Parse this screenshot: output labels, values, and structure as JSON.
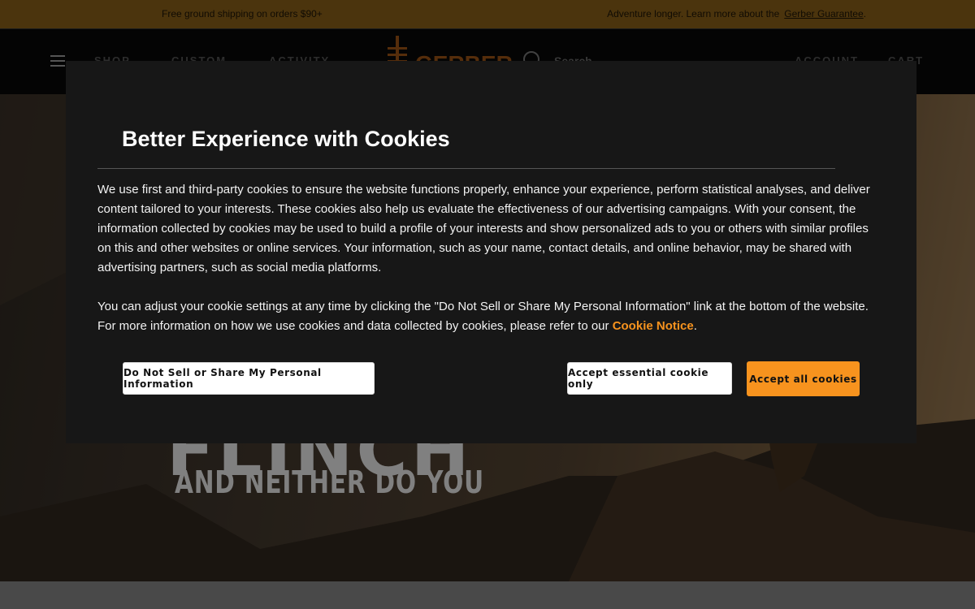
{
  "announcement": {
    "left_text": "Free ground shipping on orders $90+",
    "right_text": "Adventure longer. Learn more about the",
    "right_link": "Gerber Guarantee",
    "right_suffix": "."
  },
  "header": {
    "nav": [
      {
        "label": "SHOP"
      },
      {
        "label": "CUSTOM"
      },
      {
        "label": "ACTIVITY"
      }
    ],
    "logo_text": "GERBER",
    "search_label": "Search",
    "account_label": "ACCOUNT",
    "cart_label": "CART"
  },
  "hero": {
    "headline": "FLINCH",
    "subheadline": "AND NEITHER DO YOU"
  },
  "cookie_modal": {
    "title": "Better Experience with Cookies",
    "paragraph1": "We use first and third-party cookies to ensure the website functions properly, enhance your experience, perform statistical analyses, and deliver content tailored to your interests. These cookies also help us evaluate the effectiveness of our advertising campaigns. With your consent, the information collected by cookies may be used to build a profile of your interests and show personalized ads to you or others with similar profiles on this and other websites or online services. Your information, such as your name, contact details, and online behavior, may be shared with advertising partners, such as social media platforms.",
    "paragraph2_prefix": "You can adjust your cookie settings at any time by clicking the \"Do Not Sell or Share My Personal Information\" link at the bottom of the website. For more information on how we use cookies and data collected by cookies, please refer to our",
    "paragraph2_link": "Cookie Notice",
    "paragraph2_suffix": ".",
    "buttons": {
      "do_not_sell": "Do Not Sell or Share My Personal Information",
      "accept_essential": "Accept essential cookie only",
      "accept_all": "Accept all cookies"
    }
  },
  "colors": {
    "announcement_bg": "#7a5516",
    "header_bg": "#070707",
    "modal_bg": "#171717",
    "accent_orange": "#f7931e",
    "logo_orange": "#8a4a12"
  },
  "icons": [
    "menu-icon",
    "chevron-down-icon",
    "search-icon",
    "gerber-logo"
  ]
}
